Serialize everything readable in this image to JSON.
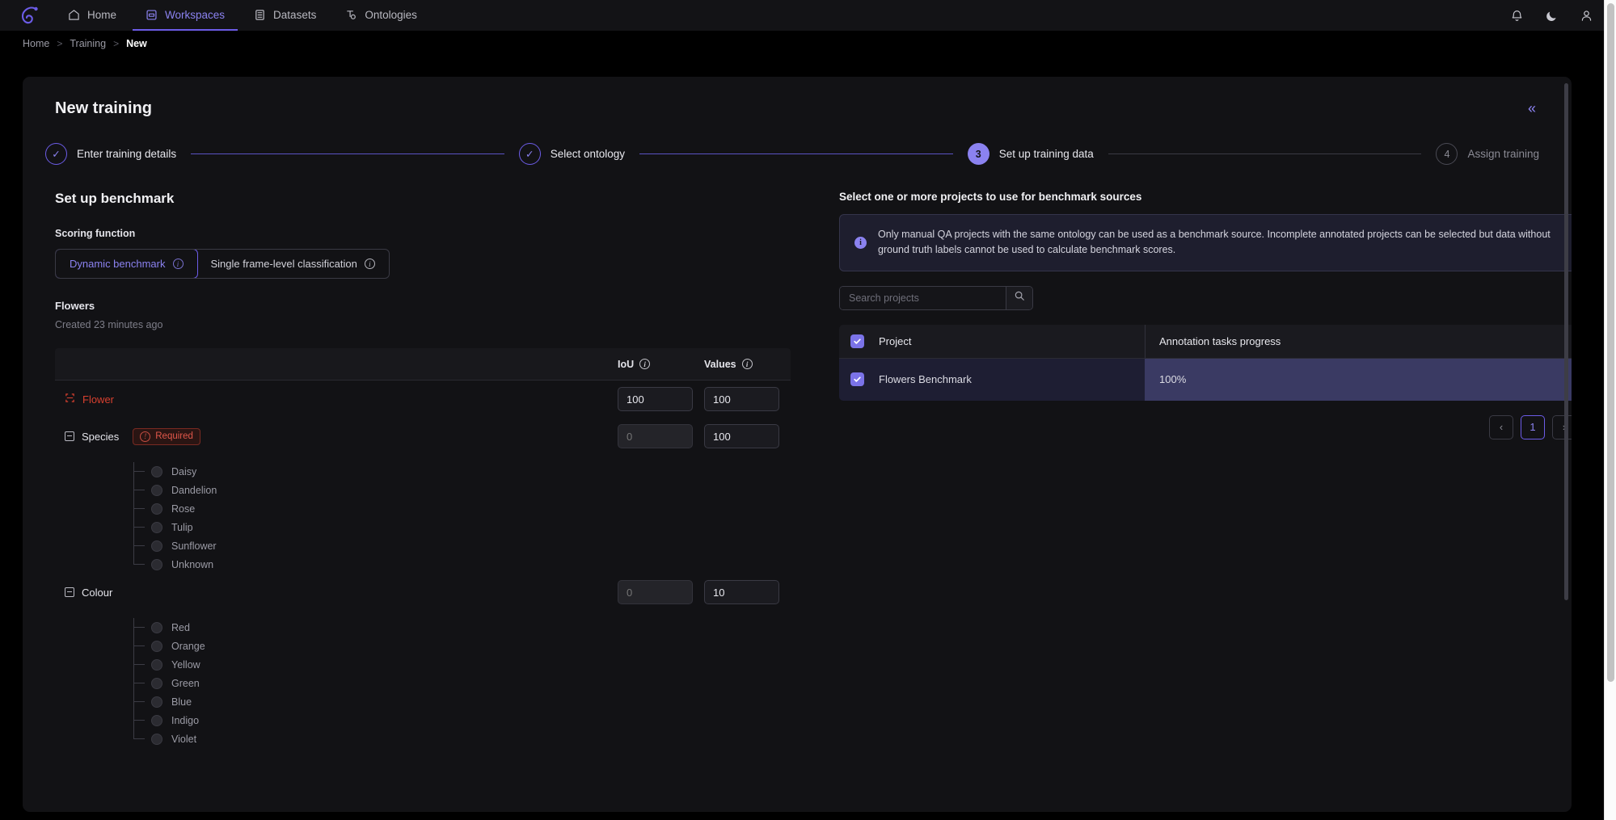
{
  "nav": {
    "brand_icon": "encord-logo",
    "items": [
      {
        "label": "Home",
        "icon": "home-icon",
        "active": false
      },
      {
        "label": "Workspaces",
        "icon": "workspaces-icon",
        "active": true
      },
      {
        "label": "Datasets",
        "icon": "datasets-icon",
        "active": false
      },
      {
        "label": "Ontologies",
        "icon": "ontologies-icon",
        "active": false
      }
    ],
    "right_icons": [
      "bell-icon",
      "moon-icon",
      "user-icon"
    ]
  },
  "breadcrumb": {
    "items": [
      "Home",
      "Training",
      "New"
    ],
    "separator": ">"
  },
  "page": {
    "title": "New training",
    "collapse_label": "«"
  },
  "stepper": {
    "steps": [
      {
        "num": "1",
        "label": "Enter training details",
        "state": "done",
        "mark": "✓"
      },
      {
        "num": "2",
        "label": "Select ontology",
        "state": "done",
        "mark": "✓"
      },
      {
        "num": "3",
        "label": "Set up training data",
        "state": "active",
        "mark": "3"
      },
      {
        "num": "4",
        "label": "Assign training",
        "state": "todo",
        "mark": "4"
      }
    ]
  },
  "benchmark": {
    "section_title": "Set up benchmark",
    "scoring_label": "Scoring function",
    "options": [
      {
        "label": "Dynamic benchmark",
        "active": true
      },
      {
        "label": "Single frame-level classification",
        "active": false
      }
    ],
    "name": "Flowers",
    "created": "Created 23 minutes ago",
    "columns": {
      "iou": "IoU",
      "values": "Values"
    },
    "rows": [
      {
        "name": "Flower",
        "type": "object",
        "icon": "bounding-box-icon",
        "required": false,
        "iou": "100",
        "iou_disabled": false,
        "iou_placeholder": "",
        "values": "100"
      },
      {
        "name": "Species",
        "type": "attribute",
        "icon": "collapse-icon",
        "required": true,
        "required_label": "Required",
        "iou": "",
        "iou_disabled": true,
        "iou_placeholder": "0",
        "values": "100",
        "children": [
          "Daisy",
          "Dandelion",
          "Rose",
          "Tulip",
          "Sunflower",
          "Unknown"
        ]
      },
      {
        "name": "Colour",
        "type": "attribute",
        "icon": "collapse-icon",
        "required": false,
        "iou": "",
        "iou_disabled": true,
        "iou_placeholder": "0",
        "values": "10",
        "children": [
          "Red",
          "Orange",
          "Yellow",
          "Green",
          "Blue",
          "Indigo",
          "Violet"
        ]
      }
    ]
  },
  "projects": {
    "title": "Select one or more projects to use for benchmark sources",
    "info": "Only manual QA projects with the same ontology can be used as a benchmark source. Incomplete annotated projects can be selected but data without ground truth labels cannot be used to calculate benchmark scores.",
    "search_placeholder": "Search projects",
    "search_value": "",
    "columns": [
      "Project",
      "Annotation tasks progress"
    ],
    "header_checked": true,
    "rows": [
      {
        "checked": true,
        "project": "Flowers Benchmark",
        "progress": "100%",
        "selected": true
      }
    ],
    "pagination": {
      "prev": "‹",
      "pages": [
        "1"
      ],
      "current": "1",
      "next": "›"
    }
  },
  "colors": {
    "accent": "#7b73e8",
    "accent_dim": "#6c5ce7",
    "danger": "#d8402f",
    "panel": "#121215",
    "selected_row": "#3a3a63"
  }
}
